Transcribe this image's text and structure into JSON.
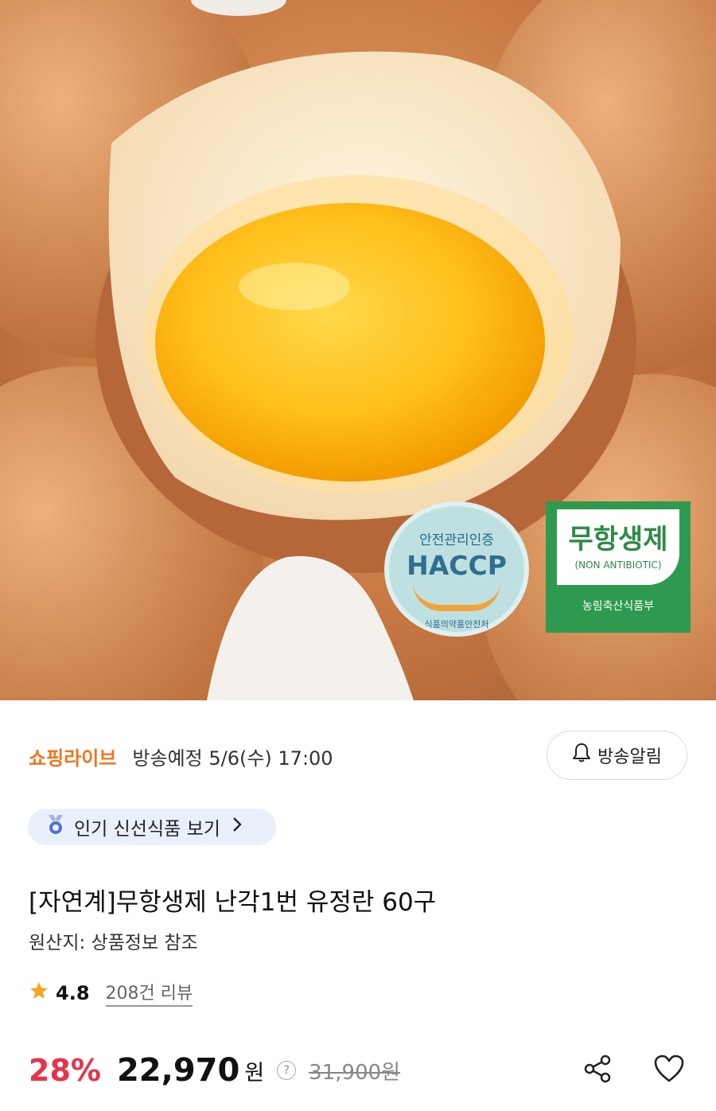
{
  "hero": {
    "badge_haccp": {
      "top": "안전관리인증",
      "main": "HACCP",
      "bottom": "식품의약품안전처"
    },
    "badge_antibiotic": {
      "main": "무항생제",
      "sub": "(NON ANTIBIOTIC)",
      "bottom": "농림축산식품부"
    }
  },
  "live": {
    "brand": "쇼핑라이브",
    "schedule": "방송예정 5/6(수) 17:00",
    "alarm_label": "방송알림"
  },
  "popular_pill": {
    "label": "인기 신선식품 보기"
  },
  "product": {
    "title": "[자연계]무항생제 난각1번 유정란 60구",
    "origin": "원산지: 상품정보 참조",
    "rating": "4.8",
    "reviews": "208건 리뷰"
  },
  "price": {
    "discount": "28%",
    "sale": "22,970",
    "currency": "원",
    "help": "?",
    "original": "31,900원"
  },
  "colors": {
    "brand": "#f2741f",
    "discount": "#e8334a",
    "star": "#f5a623"
  }
}
